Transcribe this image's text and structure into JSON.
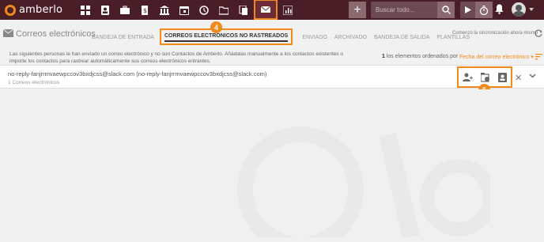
{
  "app": {
    "name": "amberlo",
    "brand_color": "#4a1e26",
    "accent": "#f08a1c"
  },
  "nav": {
    "icons": [
      "dashboard-icon",
      "contacts-icon",
      "briefcase-icon",
      "invoice-icon",
      "bank-icon",
      "calendar-icon",
      "history-icon",
      "folder-icon",
      "documents-icon",
      "mail-icon",
      "reports-icon"
    ],
    "active": "mail-icon"
  },
  "search": {
    "placeholder": "Buscar todo..."
  },
  "header": {
    "title": "Correos electrónicos"
  },
  "tabs": [
    {
      "label": "BANDEJA DE ENTRADA",
      "active": false
    },
    {
      "label": "CORREOS ELECTRÓNICOS NO RASTREADOS",
      "active": true
    },
    {
      "label": "ENVIADO",
      "active": false
    },
    {
      "label": "ARCHIVADO",
      "active": false
    },
    {
      "label": "BANDEJA DE SALIDA",
      "active": false
    },
    {
      "label": "PLANTILLAS",
      "active": false
    }
  ],
  "badges": {
    "b4": "4",
    "b5": "5"
  },
  "sync": {
    "text": "Comenzó la sincronización ahora mismo"
  },
  "info": {
    "text": "Las siguientes personas le han enviado un correo electrónico y no son Contactos de Amberlo. Añádalas manualmente a los contactos existentes o importe los contactos para rastrear automáticamente sus correos electrónicos entrantes."
  },
  "list": {
    "count": "1",
    "count_suffix": " los elementos ordenados por",
    "sort": "Fecha del correo electrónico",
    "row": {
      "address": "no-reply-fanjrrmvaewpccov3bxdjcss@slack.com (no-reply-fanjrrmvaewpccov3bxdjcss@slack.com)",
      "subtext": "1 Correos electrónicos"
    }
  }
}
